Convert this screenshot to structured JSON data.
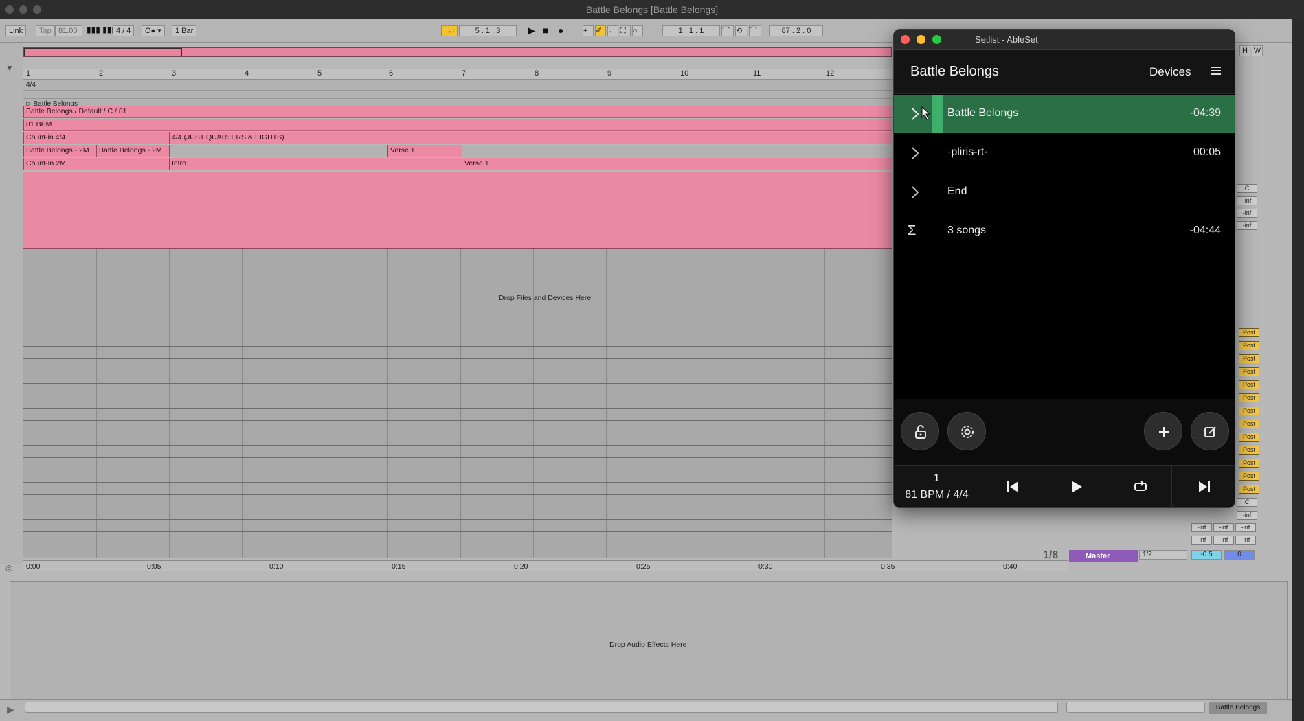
{
  "ableton": {
    "window_title": "Battle Belongs  [Battle Belongs]",
    "toolbar": {
      "link": "Link",
      "tap": "Tap",
      "tempo": "81.00",
      "time_sig": "4 / 4",
      "quantize": "1 Bar",
      "position": "5 .  1 .  3",
      "loop_start": "1 .  1 .  1",
      "loop_length": "87 .  2 .  0"
    },
    "bar_numbers": [
      "1",
      "2",
      "3",
      "4",
      "5",
      "6",
      "7",
      "8",
      "9",
      "10",
      "11",
      "12"
    ],
    "locator_strip": "4/4",
    "scene_label": "Battle Belongs",
    "lanes": {
      "lane1": "Battle Belongs / Default / C / 81",
      "lane2": "81 BPM",
      "lane3_a": "Count-in 4/4",
      "lane3_b": "4/4 (JUST QUARTERS & EIGHTS)",
      "lane4_a": "Battle Belongs - 2M",
      "lane4_b": "Battle Belongs - 2M",
      "lane4_c": "Verse 1",
      "lane5_a": "Count-In 2M",
      "lane5_b": "Intro",
      "lane5_c": "Verse 1"
    },
    "drop_files": "Drop Files and Devices Here",
    "drop_effects": "Drop Audio Effects Here",
    "time_labels": [
      "0:00",
      "0:05",
      "0:10",
      "0:15",
      "0:20",
      "0:25",
      "0:30",
      "0:35",
      "0:40"
    ],
    "fraction": "1/8",
    "master": "Master",
    "io_select": "1/2",
    "master_vol": "-0.5",
    "master_pan": "0",
    "post_label": "Post",
    "inf_label": "-inf",
    "c_label": "C",
    "status_clip": "Battle Belongs",
    "small_buttons": [
      "H",
      "W"
    ]
  },
  "ableset": {
    "window_title": "Setlist - AbleSet",
    "header_title": "Battle Belongs",
    "devices": "Devices",
    "songs": [
      {
        "name": "Battle Belongs",
        "duration": "-04:39",
        "active": true
      },
      {
        "name": "·pliris-rt·",
        "duration": "00:05",
        "active": false
      },
      {
        "name": "End",
        "duration": "",
        "active": false
      }
    ],
    "summary": {
      "label": "3 songs",
      "duration": "-04:44"
    },
    "transport": {
      "position": "1",
      "bpm_sig": "81 BPM / 4/4"
    },
    "colors": {
      "active_row": "#2a6f46",
      "accent": "#3fae6a"
    }
  }
}
